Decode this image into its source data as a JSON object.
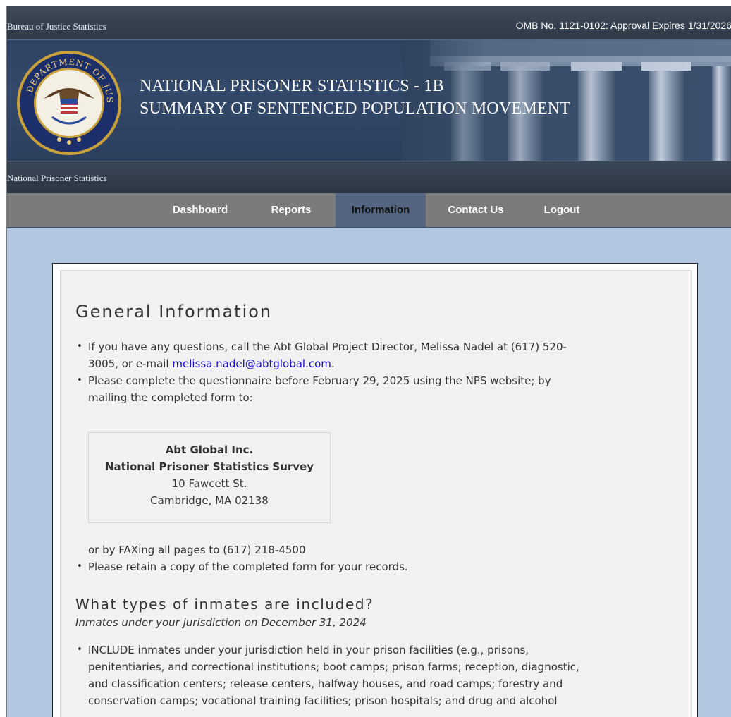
{
  "header": {
    "agency": "Bureau of Justice Statistics",
    "omb": "OMB No. 1121-0102: Approval Expires 1/31/2026",
    "title_line1": "NATIONAL PRISONER STATISTICS - 1B",
    "title_line2": "SUMMARY OF SENTENCED POPULATION MOVEMENT",
    "program": "National Prisoner Statistics",
    "seal_text": "DEPARTMENT OF JUSTICE"
  },
  "nav": {
    "items": [
      "Dashboard",
      "Reports",
      "Information",
      "Contact Us",
      "Logout"
    ],
    "active": "Information"
  },
  "content": {
    "heading": "General Information",
    "bullet1_line1": "If you have any questions, call the Abt Global Project Director, Melissa Nadel at (617) 520-",
    "bullet1_line2_pre": "3005, or e-mail ",
    "email": "melissa.nadel@abtglobal.com",
    "bullet1_line2_post": ".",
    "bullet2_line1": "Please complete the questionnaire before February 29, 2025 using the NPS website; by",
    "bullet2_line2": "mailing the completed form to:",
    "address": {
      "org": "Abt Global Inc.",
      "survey": "National Prisoner Statistics Survey",
      "street": "10 Fawcett St.",
      "city": "Cambridge, MA 02138"
    },
    "fax": "or by FAXing all pages to (617) 218-4500",
    "bullet3": "Please retain a copy of the completed form for your records.",
    "subheading": "What types of inmates are included?",
    "subcaption": "Inmates under your jurisdiction on December 31, 2024",
    "include_lines": [
      "INCLUDE inmates under your jurisdiction held in your prison facilities (e.g., prisons,",
      "penitentiaries, and correctional institutions; boot camps; prison farms; reception, diagnostic,",
      "and classification centers; release centers, halfway houses, and road camps; forestry and",
      "conservation camps; vocational training facilities; prison hospitals; and drug and alcohol"
    ]
  }
}
